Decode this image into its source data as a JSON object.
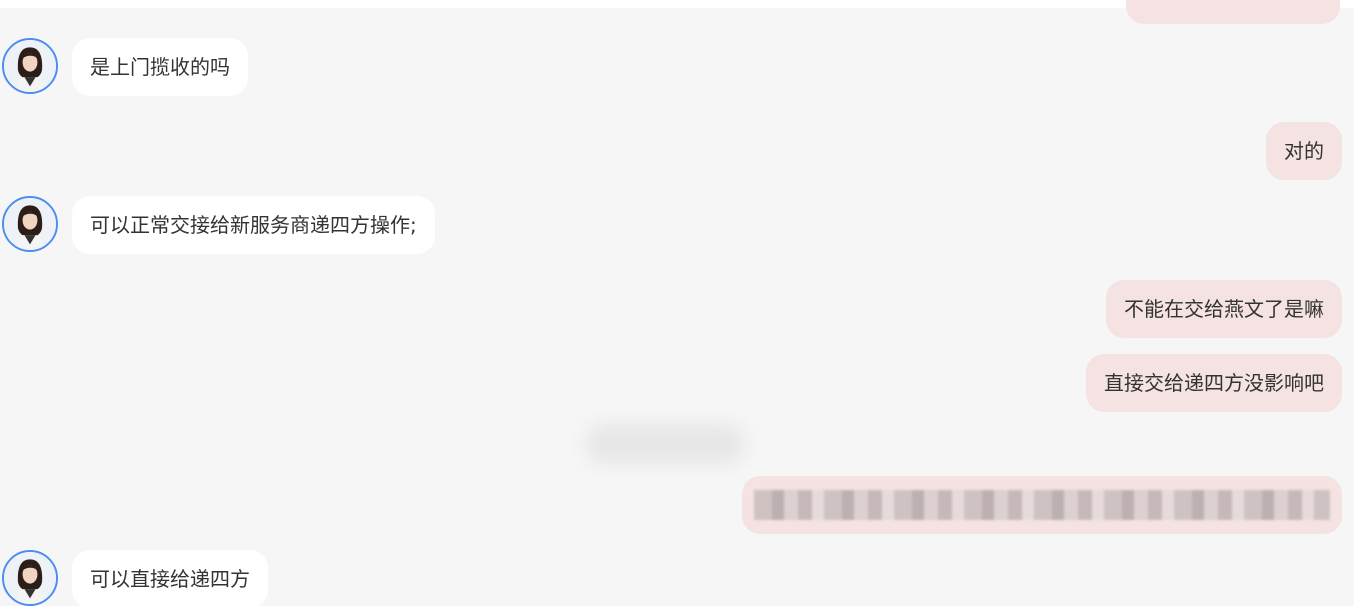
{
  "messages": [
    {
      "id": "m1",
      "side": "in",
      "text": "是上门揽收的吗"
    },
    {
      "id": "m2",
      "side": "out",
      "text": "对的"
    },
    {
      "id": "m3",
      "side": "in",
      "text": "可以正常交接给新服务商递四方操作;"
    },
    {
      "id": "m4",
      "side": "out",
      "text": "不能在交给燕文了是嘛"
    },
    {
      "id": "m5",
      "side": "out",
      "text": "直接交给递四方没影响吧"
    },
    {
      "id": "m6",
      "side": "system",
      "redacted": true
    },
    {
      "id": "m7",
      "side": "out",
      "redacted": true
    },
    {
      "id": "m8",
      "side": "in",
      "text": "可以直接给递四方"
    }
  ],
  "icons": {
    "agent_avatar": "agent-avatar-icon"
  },
  "colors": {
    "background": "#f6f6f6",
    "incoming_bubble": "#ffffff",
    "outgoing_bubble": "#f5e3e3",
    "avatar_ring": "#4b8ef0",
    "text": "#333333"
  }
}
